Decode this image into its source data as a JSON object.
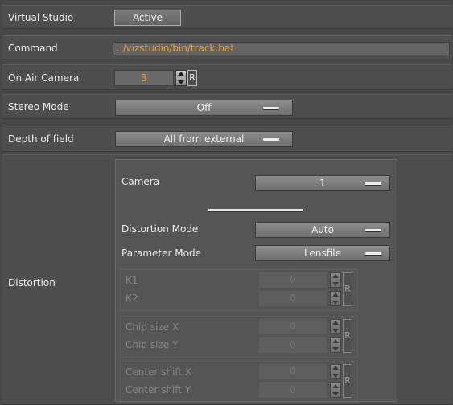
{
  "rows": {
    "virtual_studio": {
      "label": "Virtual Studio",
      "button": "Active"
    },
    "command": {
      "label": "Command",
      "value": "../vizstudio/bin/track.bat"
    },
    "on_air_camera": {
      "label": "On Air Camera",
      "value": "3",
      "reset": "R"
    },
    "stereo_mode": {
      "label": "Stereo Mode",
      "value": "Off"
    },
    "depth_of_field": {
      "label": "Depth of field",
      "value": "All from external"
    },
    "distortion": {
      "label": "Distortion"
    }
  },
  "distortion_panel": {
    "camera": {
      "label": "Camera",
      "value": "1"
    },
    "distortion_mode": {
      "label": "Distortion Mode",
      "value": "Auto"
    },
    "parameter_mode": {
      "label": "Parameter Mode",
      "value": "Lensfile"
    },
    "groups": [
      {
        "params": [
          {
            "label": "K1",
            "value": "0"
          },
          {
            "label": "K2",
            "value": "0"
          }
        ],
        "reset": "R"
      },
      {
        "params": [
          {
            "label": "Chip size X",
            "value": "0"
          },
          {
            "label": "Chip size Y",
            "value": "0"
          }
        ],
        "reset": "R"
      },
      {
        "params": [
          {
            "label": "Center shift X",
            "value": "0"
          },
          {
            "label": "Center shift Y",
            "value": "0"
          }
        ],
        "reset": "R"
      }
    ]
  },
  "colors": {
    "value_text": "#f0a020",
    "background": "#474747",
    "row_bg": "#4e4e4e"
  }
}
